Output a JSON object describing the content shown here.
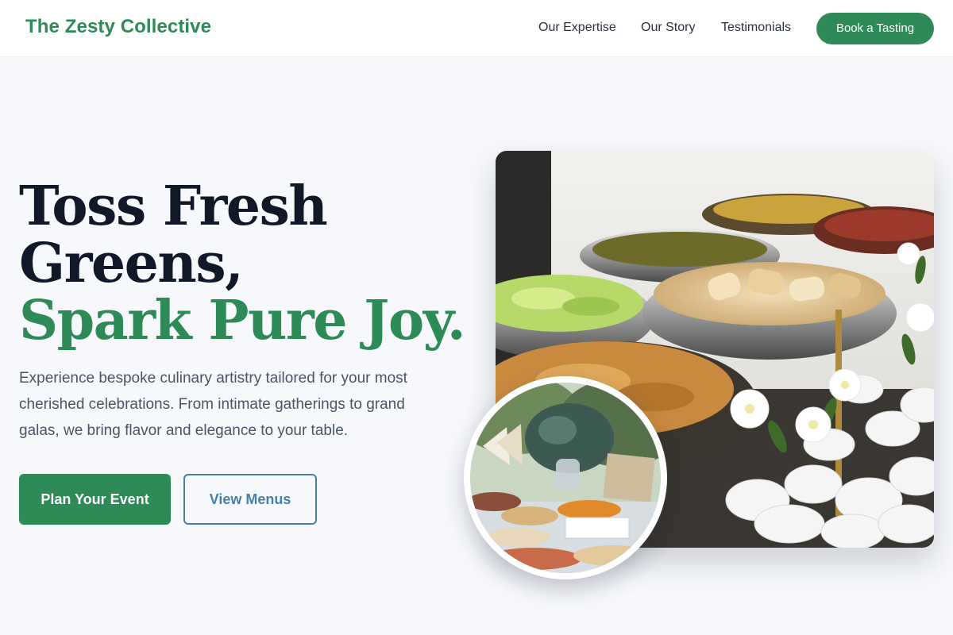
{
  "header": {
    "logo": "The Zesty Collective",
    "nav": [
      "Our Expertise",
      "Our Story",
      "Testimonials"
    ],
    "cta": "Book a Tasting"
  },
  "hero": {
    "headline_line1": "Toss Fresh",
    "headline_line2": "Greens,",
    "headline_accent": "Spark Pure Joy.",
    "description": "Experience bespoke culinary artistry tailored for your most cherished celebrations. From intimate gatherings to grand galas, we bring flavor and elegance to your table.",
    "primary_button": "Plan Your Event",
    "secondary_button": "View Menus"
  },
  "colors": {
    "brand_green": "#2e8b57",
    "outline_blue": "#4a7fa5",
    "heading_dark": "#111827",
    "page_bg": "#f6f8fc"
  },
  "images": {
    "main": "catering-buffet-photo",
    "inset": "outdoor-grazing-table-photo"
  }
}
